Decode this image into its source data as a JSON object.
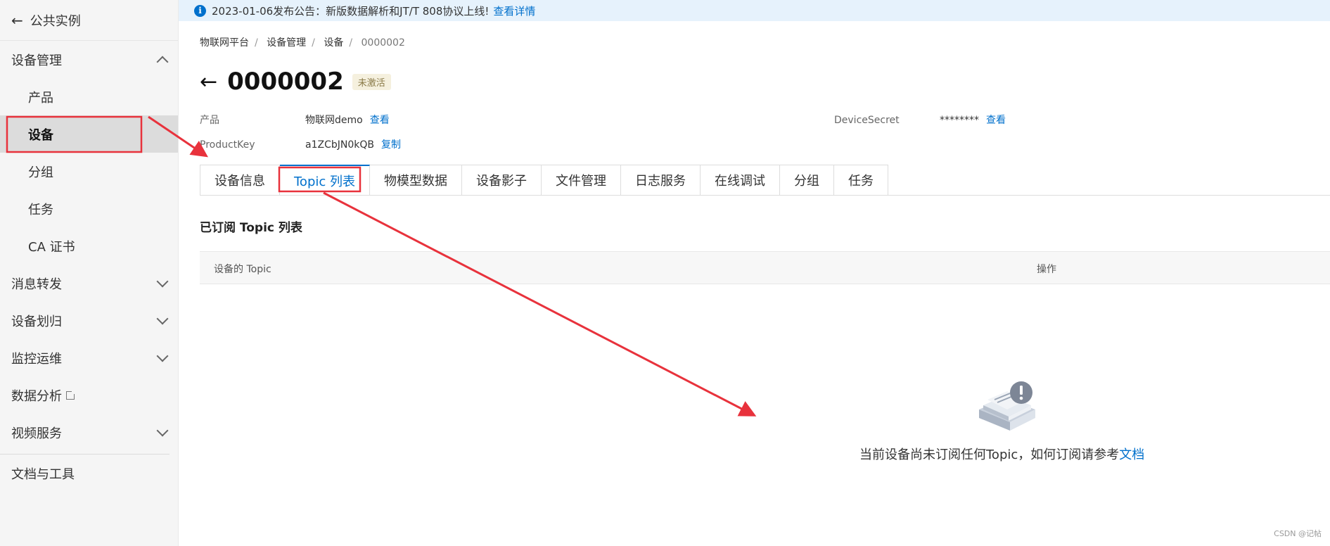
{
  "sidebar": {
    "header": "公共实例",
    "items": [
      {
        "type": "group",
        "label": "设备管理",
        "expanded": true
      },
      {
        "type": "item",
        "label": "产品"
      },
      {
        "type": "item",
        "label": "设备",
        "active": true
      },
      {
        "type": "item",
        "label": "分组"
      },
      {
        "type": "item",
        "label": "任务"
      },
      {
        "type": "item",
        "label": "CA 证书"
      },
      {
        "type": "group",
        "label": "消息转发"
      },
      {
        "type": "group",
        "label": "设备划归"
      },
      {
        "type": "group",
        "label": "监控运维"
      },
      {
        "type": "link",
        "label": "数据分析"
      },
      {
        "type": "group",
        "label": "视频服务"
      },
      {
        "type": "plain",
        "label": "文档与工具"
      }
    ]
  },
  "notice": {
    "text": "2023-01-06发布公告：新版数据解析和JT/T 808协议上线!",
    "link": "查看详情"
  },
  "breadcrumb": [
    "物联网平台",
    "设备管理",
    "设备",
    "0000002"
  ],
  "device": {
    "title": "0000002",
    "status": "未激活",
    "product_label": "产品",
    "product_value": "物联网demo",
    "product_action": "查看",
    "productkey_label": "ProductKey",
    "productkey_value": "a1ZCbJN0kQB",
    "productkey_action": "复制",
    "secret_label": "DeviceSecret",
    "secret_value": "********",
    "secret_action": "查看"
  },
  "tabs": [
    "设备信息",
    "Topic 列表",
    "物模型数据",
    "设备影子",
    "文件管理",
    "日志服务",
    "在线调试",
    "分组",
    "任务"
  ],
  "active_tab": 1,
  "section": {
    "title": "已订阅 Topic 列表",
    "col_topic": "设备的 Topic",
    "col_action": "操作"
  },
  "empty": {
    "text": "当前设备尚未订阅任何Topic，如何订阅请参考",
    "link": "文档"
  },
  "watermark": "CSDN @记帖",
  "colors": {
    "accent": "#0070cc",
    "annotation": "#e8323c"
  }
}
